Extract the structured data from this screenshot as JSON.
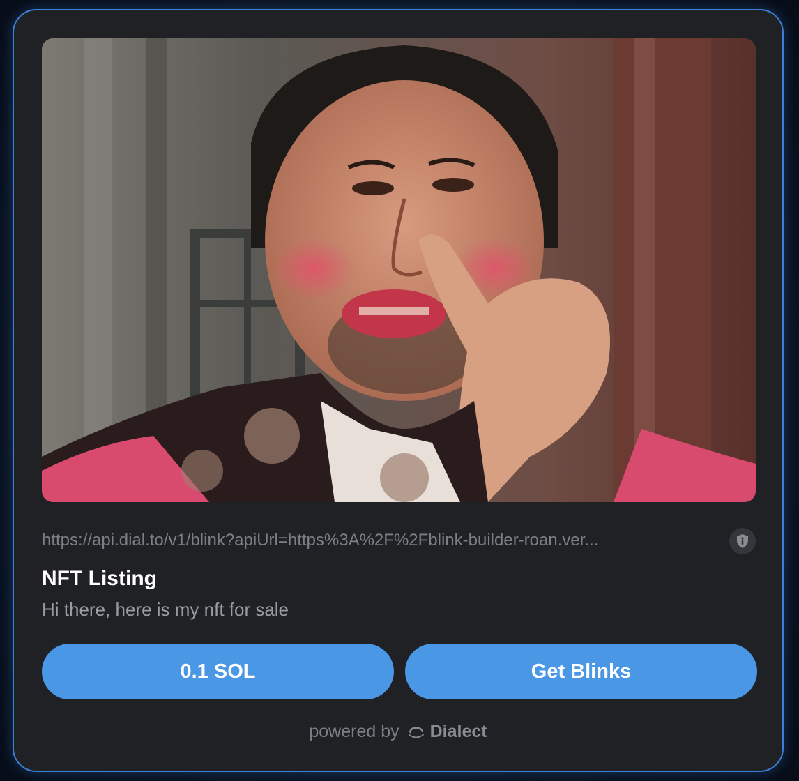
{
  "card": {
    "image_alt": "NFT image",
    "url": "https://api.dial.to/v1/blink?apiUrl=https%3A%2F%2Fblink-builder-roan.ver...",
    "security_icon": "shield-info-icon",
    "title": "NFT Listing",
    "description": "Hi there, here is my nft for sale",
    "actions": [
      {
        "label": "0.1 SOL"
      },
      {
        "label": "Get Blinks"
      }
    ],
    "footer": {
      "powered_by": "powered by",
      "brand": "Dialect",
      "brand_icon": "dialect-logo-icon"
    }
  },
  "colors": {
    "accent": "#4a97e6",
    "card_background": "#202124",
    "card_border": "#3d7fd6"
  }
}
